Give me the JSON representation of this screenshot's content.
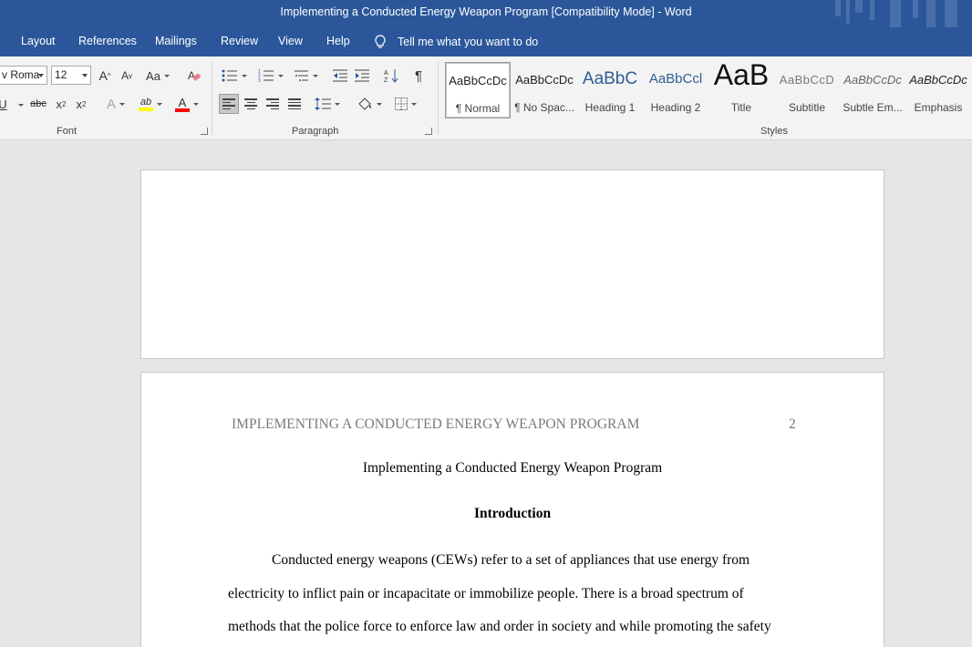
{
  "window": {
    "title": "Implementing a Conducted Energy Weapon Program [Compatibility Mode]  -  Word"
  },
  "tabs": [
    "Layout",
    "References",
    "Mailings",
    "Review",
    "View",
    "Help"
  ],
  "tell_me": {
    "icon": "lightbulb-icon",
    "label": "Tell me what you want to do"
  },
  "ribbon": {
    "font": {
      "name_value": "v Roma",
      "size_value": "12",
      "group_label": "Font",
      "grow_label": "A",
      "shrink_label": "A",
      "case_label": "Aa",
      "underline_label": "U",
      "strike_label": "abc",
      "sub_label": "x",
      "super_label": "x",
      "effects_label": "A",
      "highlight_label": "ab",
      "color_label": "A",
      "highlight_color": "#ffff00",
      "font_color": "#ff0000"
    },
    "paragraph": {
      "group_label": "Paragraph",
      "pilcrow": "¶"
    },
    "styles": {
      "group_label": "Styles",
      "items": [
        {
          "sample": "AaBbCcDc",
          "name": "¶ Normal"
        },
        {
          "sample": "AaBbCcDc",
          "name": "¶ No Spac..."
        },
        {
          "sample": "AaBbC",
          "name": "Heading 1"
        },
        {
          "sample": "AaBbCcl",
          "name": "Heading 2"
        },
        {
          "sample": "AaB",
          "name": "Title"
        },
        {
          "sample": "AaBbCcD",
          "name": "Subtitle"
        },
        {
          "sample": "AaBbCcDc",
          "name": "Subtle Em..."
        },
        {
          "sample": "AaBbCcDc",
          "name": "Emphasis"
        }
      ]
    }
  },
  "document": {
    "running_header": "IMPLEMENTING A CONDUCTED ENERGY WEAPON PROGRAM",
    "page_number": "2",
    "title": "Implementing a Conducted Energy Weapon Program",
    "heading": "Introduction",
    "body_lines": [
      "Conducted energy weapons (CEWs) refer to a set of appliances that use energy from",
      "electricity to inflict pain or incapacitate or immobilize people. There is a broad spectrum of",
      "methods that the police force to enforce law and order in society and while promoting the safety"
    ]
  },
  "colors": {
    "accent": "#2b579a",
    "ribbon_bg": "#f3f3f3",
    "canvas_bg": "#e6e6e6"
  }
}
